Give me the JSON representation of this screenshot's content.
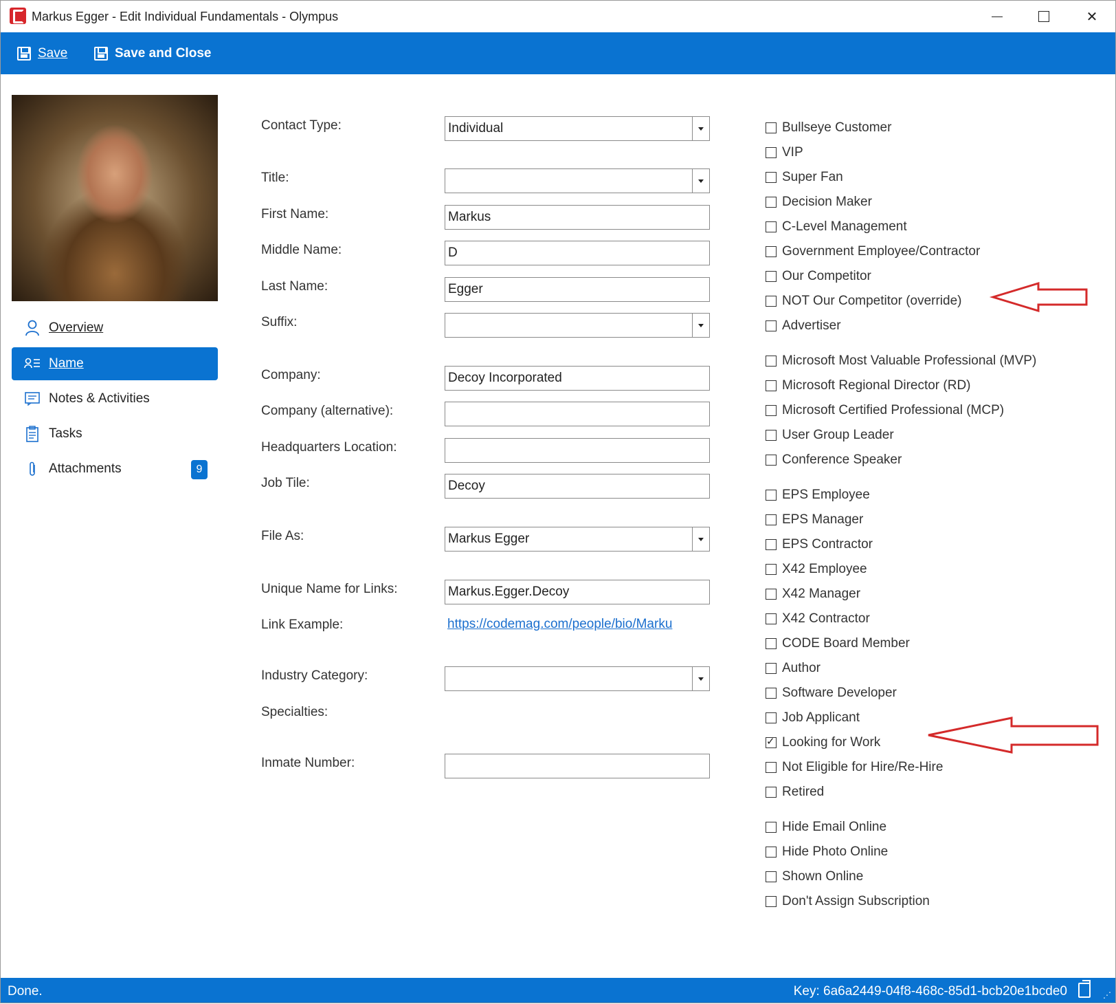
{
  "window": {
    "title": "Markus Egger - Edit Individual Fundamentals - Olympus"
  },
  "toolbar": {
    "save_label": "Save",
    "save_close_label": "Save and Close"
  },
  "sidebar": {
    "items": [
      {
        "label": "Overview",
        "icon": "person-icon"
      },
      {
        "label": "Name",
        "icon": "name-list-icon",
        "active": true
      },
      {
        "label": "Notes & Activities",
        "icon": "notes-icon"
      },
      {
        "label": "Tasks",
        "icon": "clipboard-icon"
      },
      {
        "label": "Attachments",
        "icon": "paperclip-icon",
        "badge": "9"
      }
    ]
  },
  "form": {
    "contact_type": {
      "label": "Contact Type:",
      "value": "Individual"
    },
    "title": {
      "label": "Title:",
      "value": ""
    },
    "first_name": {
      "label": "First Name:",
      "value": "Markus"
    },
    "middle_name": {
      "label": "Middle Name:",
      "value": "D"
    },
    "last_name": {
      "label": "Last Name:",
      "value": "Egger"
    },
    "suffix": {
      "label": "Suffix:",
      "value": ""
    },
    "company": {
      "label": "Company:",
      "value": "Decoy Incorporated"
    },
    "company_alt": {
      "label": "Company (alternative):",
      "value": ""
    },
    "hq_location": {
      "label": "Headquarters Location:",
      "value": ""
    },
    "job_title": {
      "label": "Job Tile:",
      "value": "Decoy"
    },
    "file_as": {
      "label": "File As:",
      "value": "Markus Egger"
    },
    "unique_name": {
      "label": "Unique Name for Links:",
      "value": "Markus.Egger.Decoy"
    },
    "link_example": {
      "label": "Link Example:",
      "value": "https://codemag.com/people/bio/Marku"
    },
    "industry_category": {
      "label": "Industry Category:",
      "value": ""
    },
    "specialties": {
      "label": "Specialties:"
    },
    "inmate_number": {
      "label": "Inmate Number:",
      "value": ""
    }
  },
  "checkboxes": [
    {
      "label": "Bullseye Customer",
      "checked": false
    },
    {
      "label": "VIP",
      "checked": false
    },
    {
      "label": "Super Fan",
      "checked": false
    },
    {
      "label": "Decision Maker",
      "checked": false
    },
    {
      "label": "C-Level Management",
      "checked": false
    },
    {
      "label": "Government Employee/Contractor",
      "checked": false
    },
    {
      "label": "Our Competitor",
      "checked": false
    },
    {
      "label": "NOT Our Competitor (override)",
      "checked": false
    },
    {
      "label": "Advertiser",
      "checked": false
    },
    {
      "label": "Microsoft Most Valuable Professional (MVP)",
      "checked": false
    },
    {
      "label": "Microsoft Regional Director (RD)",
      "checked": false
    },
    {
      "label": "Microsoft Certified Professional (MCP)",
      "checked": false
    },
    {
      "label": "User Group Leader",
      "checked": false
    },
    {
      "label": "Conference Speaker",
      "checked": false
    },
    {
      "label": "EPS Employee",
      "checked": false
    },
    {
      "label": "EPS Manager",
      "checked": false
    },
    {
      "label": "EPS Contractor",
      "checked": false
    },
    {
      "label": "X42 Employee",
      "checked": false
    },
    {
      "label": "X42 Manager",
      "checked": false
    },
    {
      "label": "X42 Contractor",
      "checked": false
    },
    {
      "label": "CODE Board Member",
      "checked": false
    },
    {
      "label": "Author",
      "checked": false
    },
    {
      "label": "Software Developer",
      "checked": false
    },
    {
      "label": "Job Applicant",
      "checked": false
    },
    {
      "label": "Looking for Work",
      "checked": true
    },
    {
      "label": "Not Eligible for Hire/Re-Hire",
      "checked": false
    },
    {
      "label": "Retired",
      "checked": false
    },
    {
      "label": "Hide Email Online",
      "checked": false
    },
    {
      "label": "Hide Photo Online",
      "checked": false
    },
    {
      "label": "Shown Online",
      "checked": false
    },
    {
      "label": "Don't Assign Subscription",
      "checked": false
    }
  ],
  "status": {
    "left": "Done.",
    "key": "Key: 6a6a2449-04f8-468c-85d1-bcb20e1bcde0"
  },
  "colors": {
    "accent": "#0a73d1",
    "annotation_arrow": "#d42a2a",
    "logo": "#d7262b"
  }
}
